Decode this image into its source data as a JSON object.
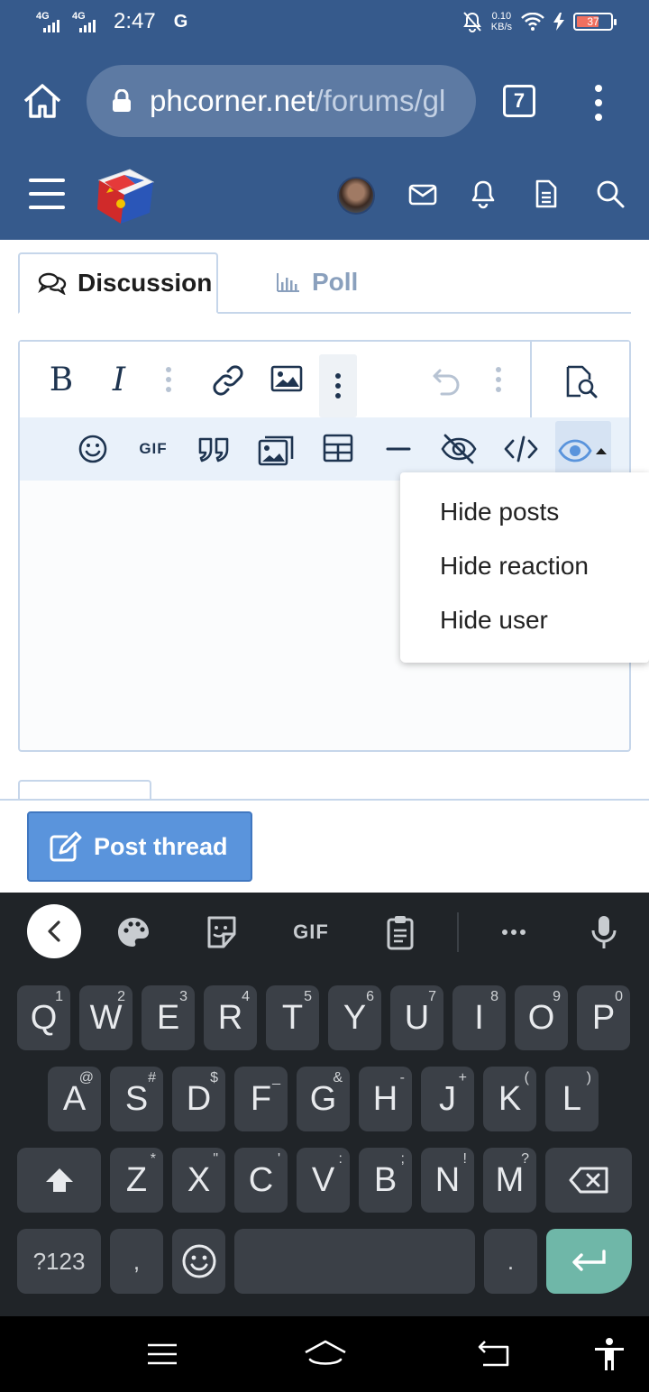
{
  "status_bar": {
    "signal1": "4G",
    "signal2": "4G",
    "time": "2:47",
    "g_badge": "G",
    "speed_value": "0.10",
    "speed_unit": "KB/s",
    "battery": "37"
  },
  "browser": {
    "url_host": "phcorner.net",
    "url_path": "/forums/gl",
    "tab_count": "7"
  },
  "header": {
    "icons": [
      "menu-icon",
      "site-logo",
      "avatar",
      "mail-icon",
      "bell-icon",
      "document-icon",
      "search-icon"
    ]
  },
  "tabs": {
    "discussion": "Discussion",
    "poll": "Poll"
  },
  "editor_toolbar": {
    "bold": "B",
    "italic": "I",
    "gif": "GIF"
  },
  "hide_menu": {
    "items": [
      "Hide posts",
      "Hide reaction",
      "Hide user"
    ]
  },
  "actions": {
    "post_thread": "Post thread"
  },
  "keyboard": {
    "suggestion_gif": "GIF",
    "row1": [
      {
        "k": "Q",
        "h": "1"
      },
      {
        "k": "W",
        "h": "2"
      },
      {
        "k": "E",
        "h": "3"
      },
      {
        "k": "R",
        "h": "4"
      },
      {
        "k": "T",
        "h": "5"
      },
      {
        "k": "Y",
        "h": "6"
      },
      {
        "k": "U",
        "h": "7"
      },
      {
        "k": "I",
        "h": "8"
      },
      {
        "k": "O",
        "h": "9"
      },
      {
        "k": "P",
        "h": "0"
      }
    ],
    "row2": [
      {
        "k": "A",
        "h": "@"
      },
      {
        "k": "S",
        "h": "#"
      },
      {
        "k": "D",
        "h": "$"
      },
      {
        "k": "F",
        "h": "_"
      },
      {
        "k": "G",
        "h": "&"
      },
      {
        "k": "H",
        "h": "-"
      },
      {
        "k": "J",
        "h": "+"
      },
      {
        "k": "K",
        "h": "("
      },
      {
        "k": "L",
        "h": ")"
      }
    ],
    "row3": [
      {
        "k": "Z",
        "h": "*"
      },
      {
        "k": "X",
        "h": "\""
      },
      {
        "k": "C",
        "h": "'"
      },
      {
        "k": "V",
        "h": ":"
      },
      {
        "k": "B",
        "h": ";"
      },
      {
        "k": "N",
        "h": "!"
      },
      {
        "k": "M",
        "h": "?"
      }
    ],
    "symbols_key": "?123",
    "comma": ",",
    "period": "."
  }
}
